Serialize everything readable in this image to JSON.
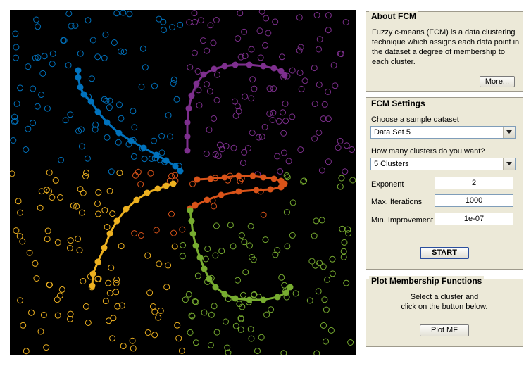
{
  "about": {
    "title": "About FCM",
    "description": "Fuzzy c-means (FCM) is a data clustering technique which assigns each data point in the dataset a degree of membership to each cluster.",
    "more_button": "More..."
  },
  "settings": {
    "title": "FCM Settings",
    "dataset_label": "Choose a sample dataset",
    "dataset_value": "Data Set 5",
    "clusters_label": "How many clusters do you want?",
    "clusters_value": "5 Clusters",
    "exponent_label": "Exponent",
    "exponent_value": "2",
    "max_iter_label": "Max. Iterations",
    "max_iter_value": "1000",
    "min_improve_label": "Min. Improvement",
    "min_improve_value": "1e-07",
    "start_button": "START"
  },
  "membership": {
    "title": "Plot Membership Functions",
    "instruction_line1": "Select a cluster and",
    "instruction_line2": "click on the button below.",
    "plot_button": "Plot MF"
  },
  "colors": {
    "blue": "#0072bd",
    "purple": "#7e2f8e",
    "orange": "#d95319",
    "yellow": "#edb120",
    "green": "#77ac30",
    "plot_background": "#000000"
  }
}
